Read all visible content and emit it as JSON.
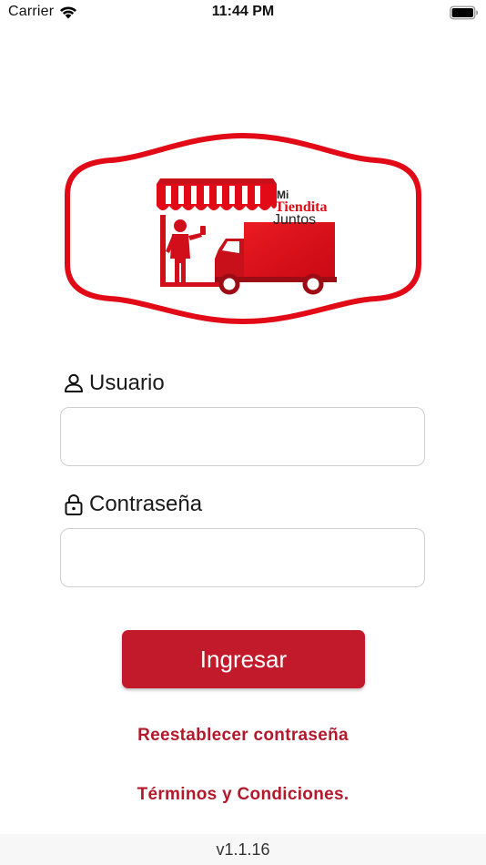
{
  "status_bar": {
    "carrier": "Carrier",
    "time": "11:44 PM",
    "wifi_icon": "wifi-icon",
    "battery_icon": "battery-icon"
  },
  "logo": {
    "line1": "Mi",
    "line2": "Tiendita",
    "line3": "Juntos",
    "accent_color": "#e10a16"
  },
  "form": {
    "user_label": "Usuario",
    "user_icon": "user-icon",
    "user_value": "",
    "password_label": "Contraseña",
    "password_icon": "lock-icon",
    "password_value": ""
  },
  "login_button": {
    "label": "Ingresar",
    "color": "#c21a2a"
  },
  "links": {
    "reset_password": "Reestablecer contraseña",
    "terms": "Términos y Condiciones."
  },
  "footer": {
    "version": "v1.1.16"
  }
}
